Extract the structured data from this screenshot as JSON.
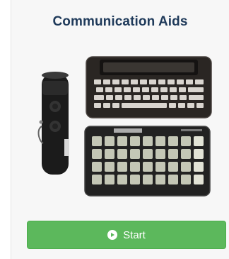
{
  "card": {
    "title": "Communication Aids",
    "image_icon": "communication-devices-photo",
    "start_label": "Start",
    "start_icon": "play-circle-icon"
  },
  "colors": {
    "title": "#1f3a5a",
    "button": "#5cb85c",
    "card_background": "#f7f7f7"
  }
}
